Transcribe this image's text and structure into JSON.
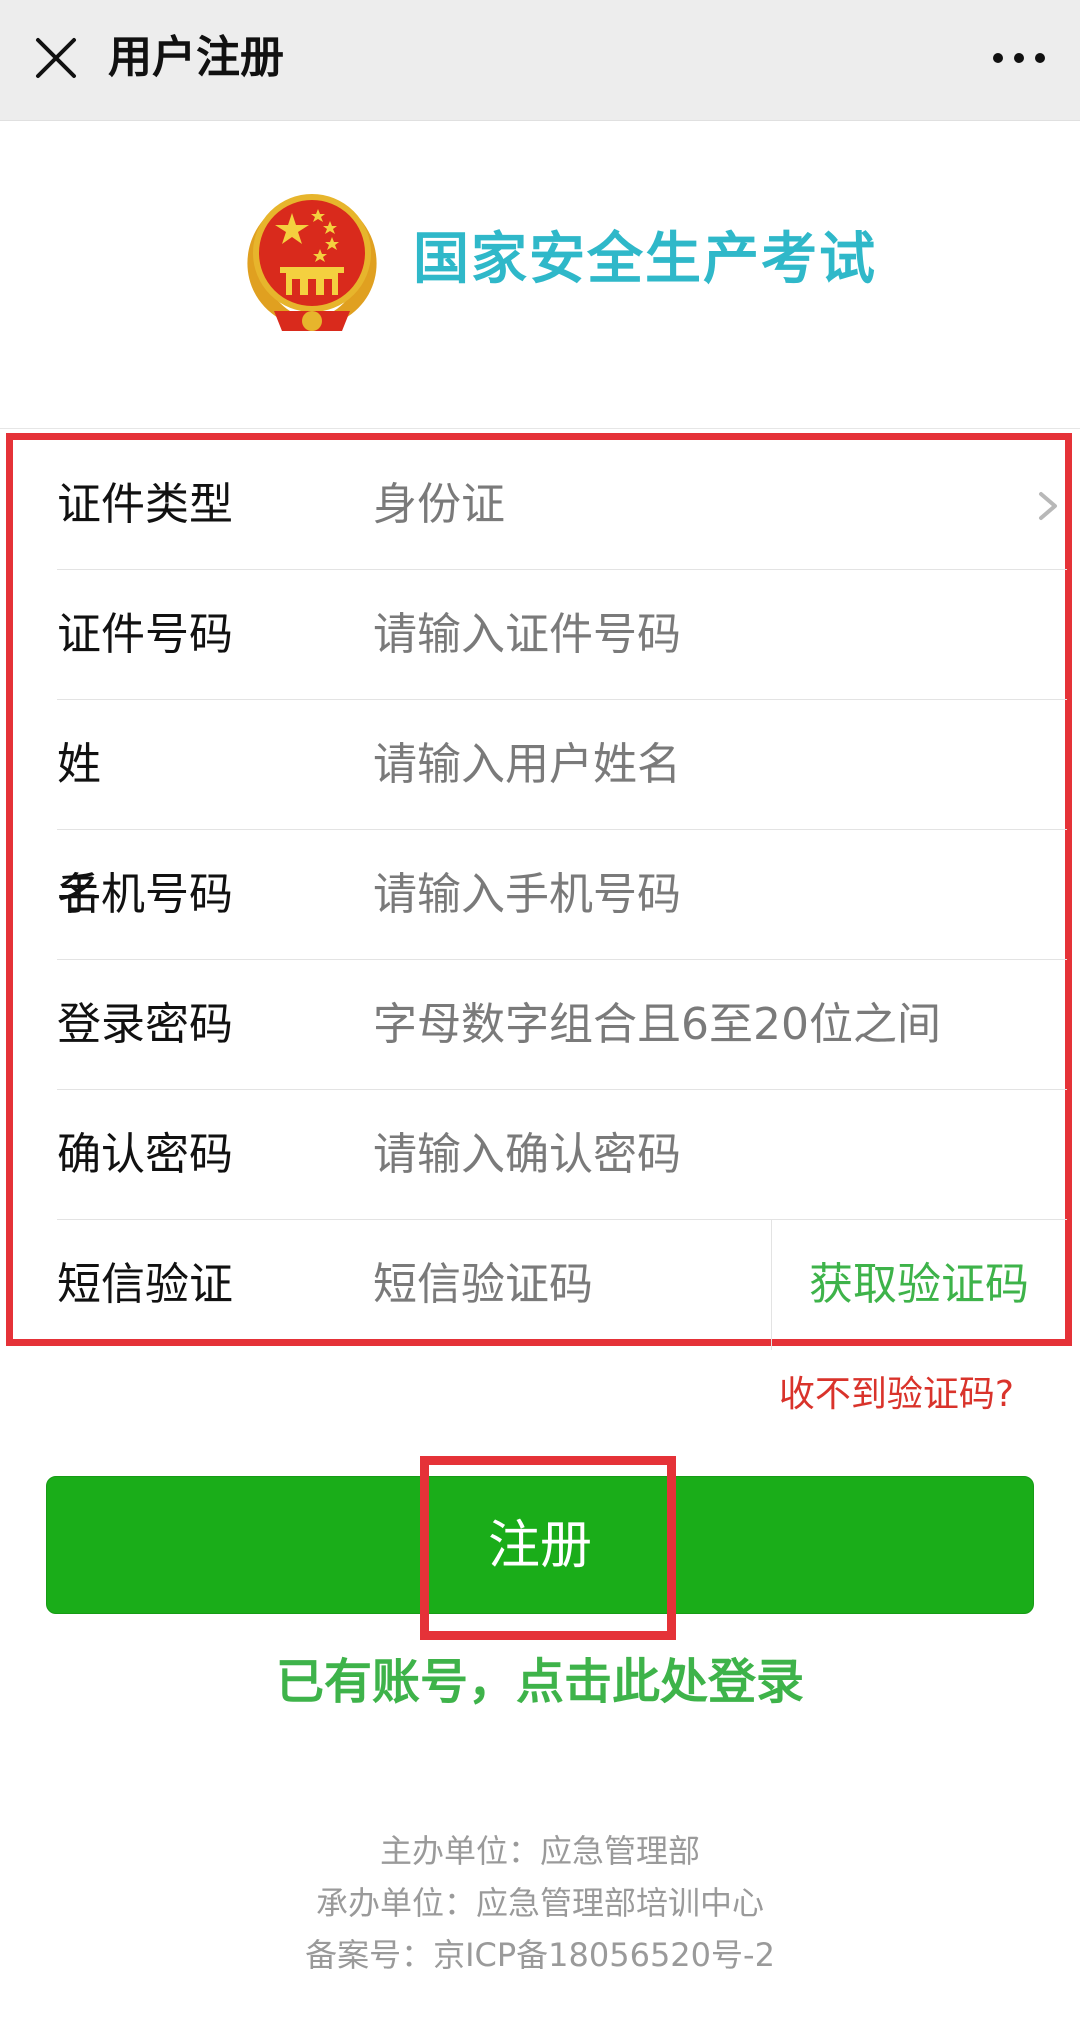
{
  "navbar": {
    "title": "用户注册"
  },
  "brand": {
    "title": "国家安全生产考试"
  },
  "form": {
    "id_type": {
      "label": "证件类型",
      "value": "身份证"
    },
    "id_number": {
      "label": "证件号码",
      "placeholder": "请输入证件号码"
    },
    "name": {
      "label": "姓名",
      "placeholder": "请输入用户姓名"
    },
    "phone": {
      "label": "手机号码",
      "placeholder": "请输入手机号码"
    },
    "password": {
      "label": "登录密码",
      "placeholder": "字母数字组合且6至20位之间"
    },
    "confirm_password": {
      "label": "确认密码",
      "placeholder": "请输入确认密码"
    },
    "sms": {
      "label": "短信验证",
      "placeholder": "短信验证码",
      "get_code": "获取验证码"
    }
  },
  "no_code_link": "收不到验证码?",
  "register_button": "注册",
  "login_link": "已有账号，点击此处登录",
  "footer": {
    "sponsor": "主办单位：应急管理部",
    "organizer": "承办单位：应急管理部培训中心",
    "icp": "备案号：京ICP备18056520号-2"
  },
  "colors": {
    "accent_green": "#1aad19",
    "link_green": "#3eb34a",
    "brand_teal": "#2fb8c9",
    "highlight_red": "#e53238",
    "warning_red": "#d9332b"
  }
}
